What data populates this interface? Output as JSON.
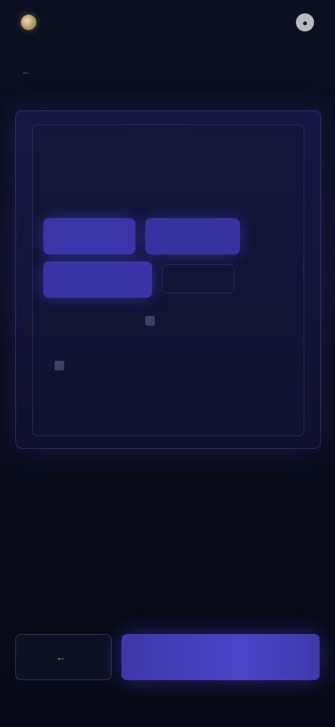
{
  "header": {
    "brand_name": "",
    "status_text": "",
    "profile_icon": "person-icon"
  },
  "breadcrumb": {
    "text": ""
  },
  "back_link": {
    "label": "",
    "icon": "arrow-left-icon"
  },
  "card": {
    "title": "",
    "options_label": ""
  },
  "options": [
    "",
    "",
    "",
    ""
  ],
  "details": [
    "",
    "",
    "",
    "",
    "",
    ""
  ],
  "footer": {
    "secondary_label": "",
    "secondary_icon": "arrow-left-icon",
    "primary_label": ""
  },
  "colors": {
    "accent": "#3d37a8",
    "background": "#070c18",
    "card_border": "#5046b4"
  }
}
